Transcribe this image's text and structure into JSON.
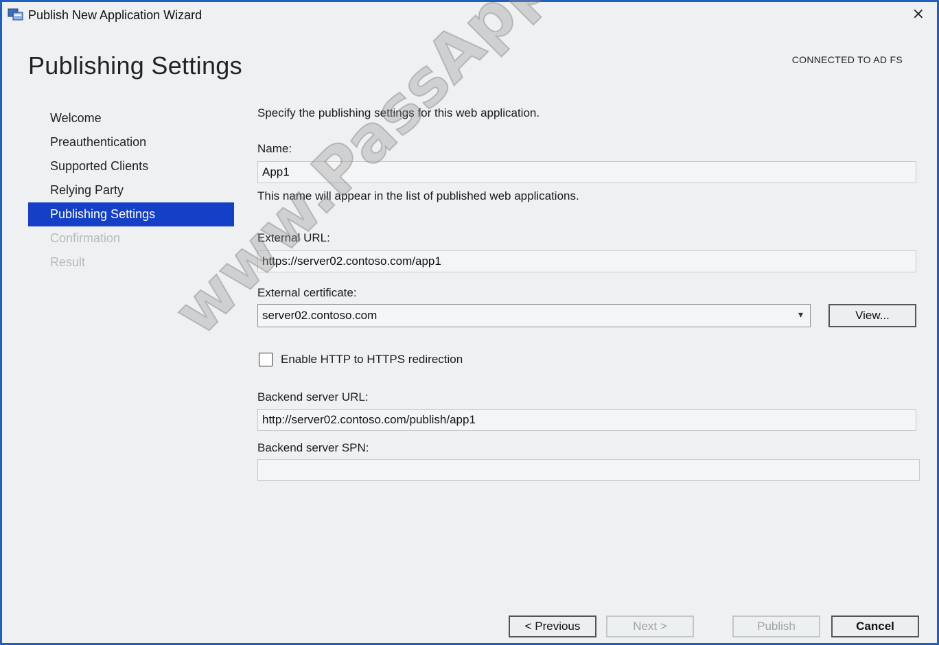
{
  "window": {
    "title": "Publish New Application Wizard",
    "close_label": "×"
  },
  "header": {
    "page_title": "Publishing Settings",
    "connection_status": "CONNECTED TO AD FS"
  },
  "nav": {
    "items": [
      {
        "label": "Welcome",
        "state": "normal"
      },
      {
        "label": "Preauthentication",
        "state": "normal"
      },
      {
        "label": "Supported Clients",
        "state": "normal"
      },
      {
        "label": "Relying Party",
        "state": "normal"
      },
      {
        "label": "Publishing Settings",
        "state": "selected"
      },
      {
        "label": "Confirmation",
        "state": "disabled"
      },
      {
        "label": "Result",
        "state": "disabled"
      }
    ]
  },
  "form": {
    "intro": "Specify the publishing settings for this web application.",
    "name_label": "Name:",
    "name_value": "App1",
    "name_hint": "This name will appear in the list of published web applications.",
    "external_url_label": "External URL:",
    "external_url_value": "https://server02.contoso.com/app1",
    "external_cert_label": "External certificate:",
    "external_cert_value": "server02.contoso.com",
    "view_button": "View...",
    "redirect_checkbox_label": "Enable HTTP to HTTPS redirection",
    "redirect_checked": false,
    "backend_url_label": "Backend server URL:",
    "backend_url_value": "http://server02.contoso.com/publish/app1",
    "backend_spn_label": "Backend server SPN:",
    "backend_spn_value": ""
  },
  "footer": {
    "previous": "< Previous",
    "next": "Next >",
    "publish": "Publish",
    "cancel": "Cancel"
  },
  "watermark": "www.PassApply.com",
  "colors": {
    "selection": "#1440c8",
    "window_border": "#1f5fbf"
  }
}
